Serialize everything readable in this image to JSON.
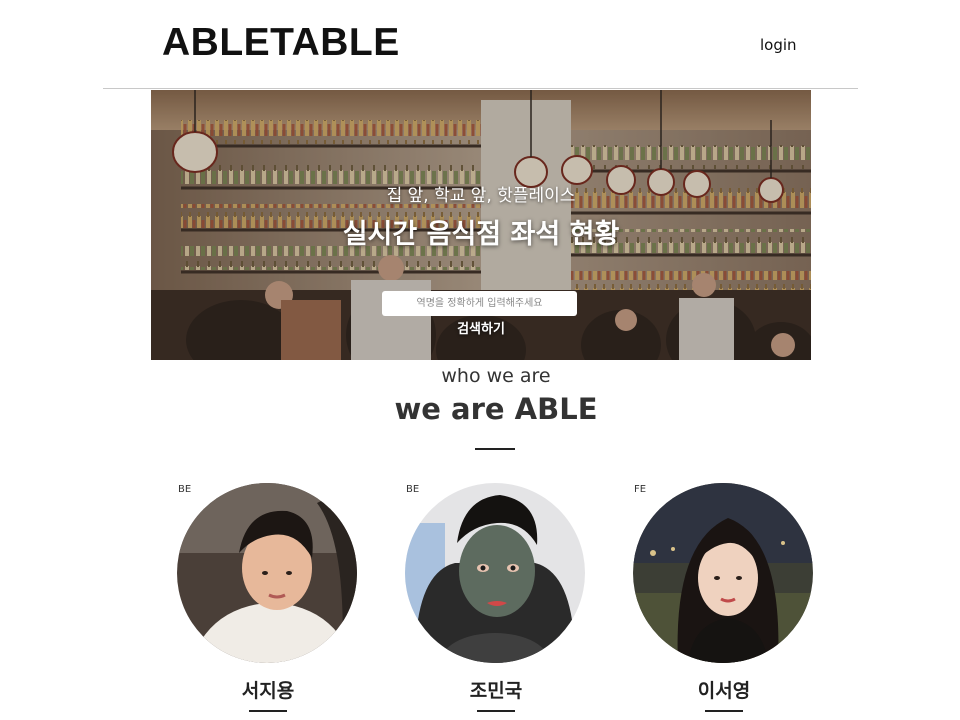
{
  "header": {
    "logo": "ABLETABLE",
    "login_label": "login"
  },
  "hero": {
    "subtitle": "집 앞, 학교 앞, 핫플레이스",
    "title": "실시간 음식점 좌석 현황",
    "search_placeholder": "역명을 정확하게 입력해주세요",
    "search_button": "검색하기"
  },
  "about": {
    "small_heading": "who we are",
    "big_heading": "we are ABLE"
  },
  "members": [
    {
      "role": "BE",
      "name": "서지용"
    },
    {
      "role": "BE",
      "name": "조민국"
    },
    {
      "role": "FE",
      "name": "이서영"
    }
  ],
  "colors": {
    "text": "#222222",
    "divider": "#c8c8c8",
    "hero_overlay_text": "#ffffff"
  }
}
